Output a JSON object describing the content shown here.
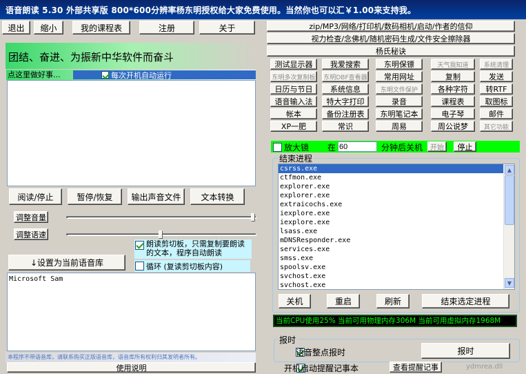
{
  "titlebar": {
    "text": "语音朗读 5.30 外部共享版 800*600分辨率杨东明授权给大家免费使用。当然你也可以汇￥1.00来支持我。"
  },
  "toolbar": {
    "exit": "退出",
    "minimize": "缩小",
    "my_courses": "我的课程表",
    "register": "注册",
    "about": "关于"
  },
  "banner": {
    "text": "团结、奋进、为振新中华软件而奋斗"
  },
  "good_deed": {
    "text": "点这里做好事...",
    "autorun_label": "每次开机自动运行"
  },
  "playback": {
    "read_stop": "阅读/停止",
    "pause_resume": "暂停/恢复",
    "export_audio": "输出声音文件",
    "text_convert": "文本转换"
  },
  "volume_label": "调整音量",
  "speed_label": "调整语速",
  "volume_level": 1.0,
  "speed_level": 0.5,
  "clipboard_read_label": "朗读剪切板，只需复制要朗读的文本，程序自动朗读",
  "loop_label": "循环 (复读剪切板内容)",
  "set_voice_button": "↓设置为当前语音库",
  "voice_list": [
    "Microsoft Sam"
  ],
  "footer_notice": "本程序不带语音库，请联系购买正版语音库，语音库所有权利归其发明者所有。",
  "help_button": "使用说明",
  "right_top": {
    "zip_mp3": "zip/MP3/网络/打印机/数码相机/启动/作者的信仰",
    "vision": "视力检查/念佛机/随机密码生成/文件安全擦除器",
    "secret": "杨氏秘诀"
  },
  "tools_grid": [
    [
      "测试显示器",
      "我爱搜索",
      "东明保镖",
      "天气我知道",
      "系统清理"
    ],
    [
      "东明多次复制板",
      "东明DBF查看器",
      "常用网址",
      "复制",
      "发送"
    ],
    [
      "日历与节日",
      "系统信息",
      "东明文件保护",
      "各种字符",
      "转RTF"
    ],
    [
      "语音输入法",
      "特大字打印",
      "录音",
      "课程表",
      "取图标"
    ],
    [
      "帐本",
      "备份注册表",
      "东明笔记本",
      "电子琴",
      "邮件"
    ],
    [
      "XP一肥",
      "常识",
      "周易",
      "周公说梦",
      "其它功能"
    ]
  ],
  "shutdown": {
    "magnifier_label": "放大镜",
    "at_label": "在",
    "minutes_value": "60",
    "after_label": "分钟后关机",
    "start": "开始",
    "stop": "停止"
  },
  "process": {
    "group_title": "结束进程",
    "items": [
      "csrss.exe",
      "ctfmon.exe",
      "explorer.exe",
      "explorer.exe",
      "extraicochs.exe",
      "iexplore.exe",
      "iexplore.exe",
      "lsass.exe",
      "mDNSResponder.exe",
      "services.exe",
      "smss.exe",
      "spoolsv.exe",
      "svchost.exe",
      "svchost.exe"
    ],
    "shutdown": "关机",
    "restart": "重启",
    "refresh": "刷新",
    "end_selected": "结束选定进程"
  },
  "status_bar": "当前CPU使用25%  当前可用物理内存306M  当前可用虚拟内存1968M",
  "hourly": {
    "group_title": "报时",
    "voice_label": "语音整点报时",
    "button": "报时"
  },
  "reminder": {
    "label": "开机启动提醒记事本",
    "view_button": "查看提醒记事",
    "watermark": "ydmrea.dll"
  },
  "colors": {
    "title_bg": "#0a246a",
    "banner_green": "#3ad86a",
    "status_green": "#00ff00",
    "select_blue": "#316ac5"
  }
}
